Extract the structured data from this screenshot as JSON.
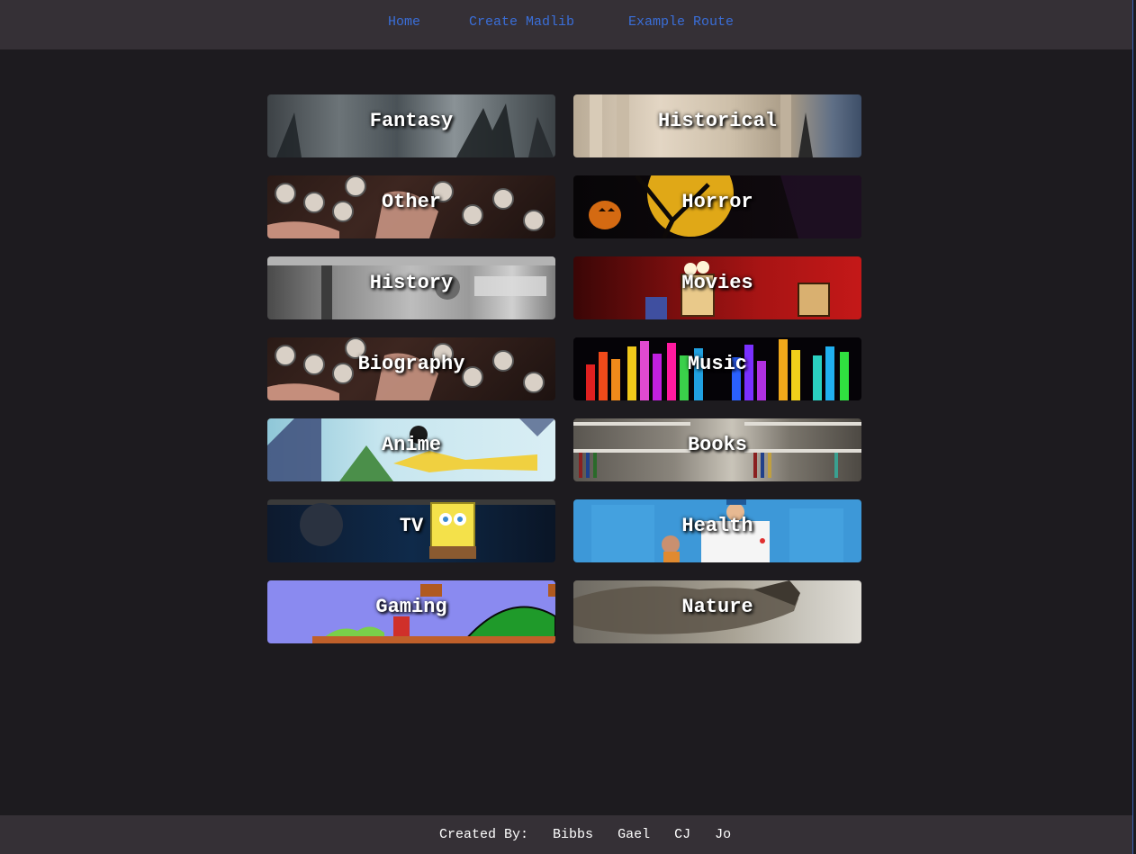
{
  "nav": {
    "links": [
      "Home",
      "Create Madlib",
      "Example Route"
    ]
  },
  "categories": [
    {
      "label": "Fantasy",
      "art": "fantasy-art"
    },
    {
      "label": "Historical",
      "art": "historical-art"
    },
    {
      "label": "Other",
      "art": "other-art"
    },
    {
      "label": "Horror",
      "art": "horror-art"
    },
    {
      "label": "History",
      "art": "history-art"
    },
    {
      "label": "Movies",
      "art": "movies-art"
    },
    {
      "label": "Biography",
      "art": "biography-art"
    },
    {
      "label": "Music",
      "art": "music-art"
    },
    {
      "label": "Anime",
      "art": "anime-art"
    },
    {
      "label": "Books",
      "art": "books-art"
    },
    {
      "label": "TV",
      "art": "tv-art"
    },
    {
      "label": "Health",
      "art": "health-art"
    },
    {
      "label": "Gaming",
      "art": "gaming-art"
    },
    {
      "label": "Nature",
      "art": "nature-art"
    }
  ],
  "footer": {
    "prefix": "Created By:",
    "authors": [
      "Bibbs",
      "Gael",
      "CJ",
      "Jo"
    ]
  },
  "colors": {
    "background": "#1d1b1f",
    "bar": "#353036",
    "link": "#3a6ed8"
  }
}
